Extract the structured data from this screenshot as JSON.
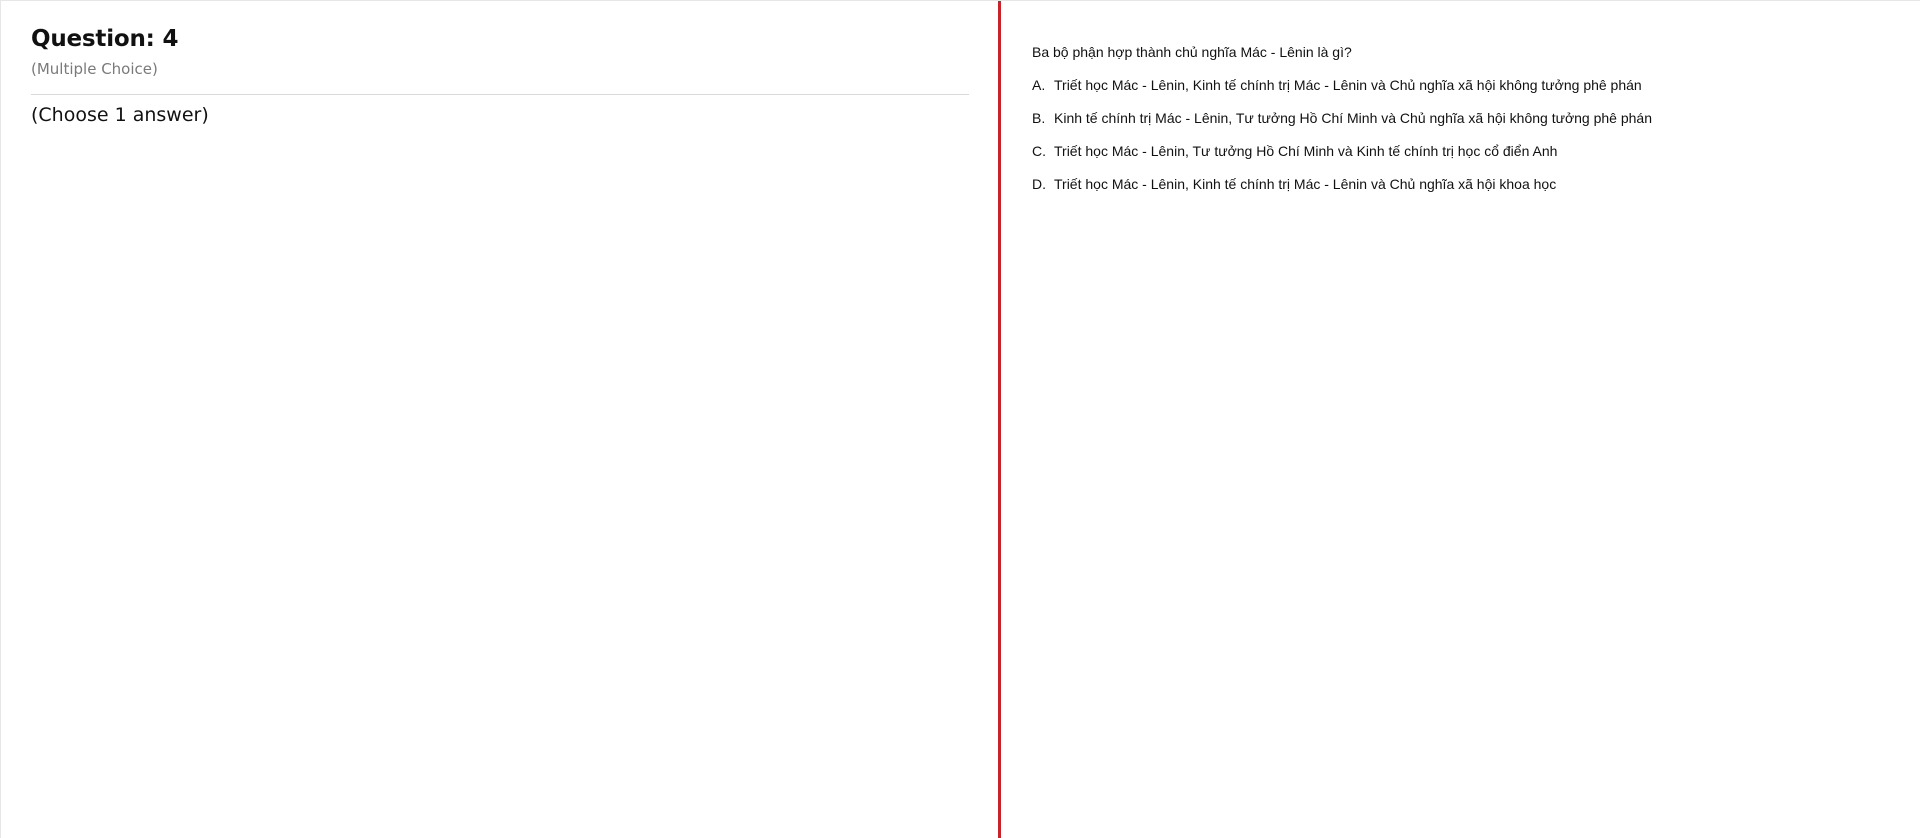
{
  "question": {
    "title": "Question: 4",
    "type": "(Multiple Choice)",
    "instruction": "(Choose 1 answer)"
  },
  "content": {
    "prompt": "Ba bộ phận hợp thành chủ nghĩa Mác - Lênin là gì?",
    "options": [
      {
        "letter": "A.",
        "text": "Triết học Mác - Lênin, Kinh tế chính trị Mác - Lênin và Chủ nghĩa xã hội không tưởng phê phán"
      },
      {
        "letter": "B.",
        "text": "Kinh tế chính trị Mác - Lênin, Tư tưởng Hồ Chí Minh và Chủ nghĩa xã hội không tưởng phê phán"
      },
      {
        "letter": "C.",
        "text": "Triết học Mác - Lênin, Tư tưởng Hồ Chí Minh và Kinh tế chính trị học cổ điển Anh"
      },
      {
        "letter": "D.",
        "text": "Triết học Mác - Lênin, Kinh tế chính trị Mác - Lênin và Chủ nghĩa xã hội khoa học"
      }
    ]
  },
  "colors": {
    "divider": "#c8232a",
    "muted_text": "#7a7a7a"
  }
}
